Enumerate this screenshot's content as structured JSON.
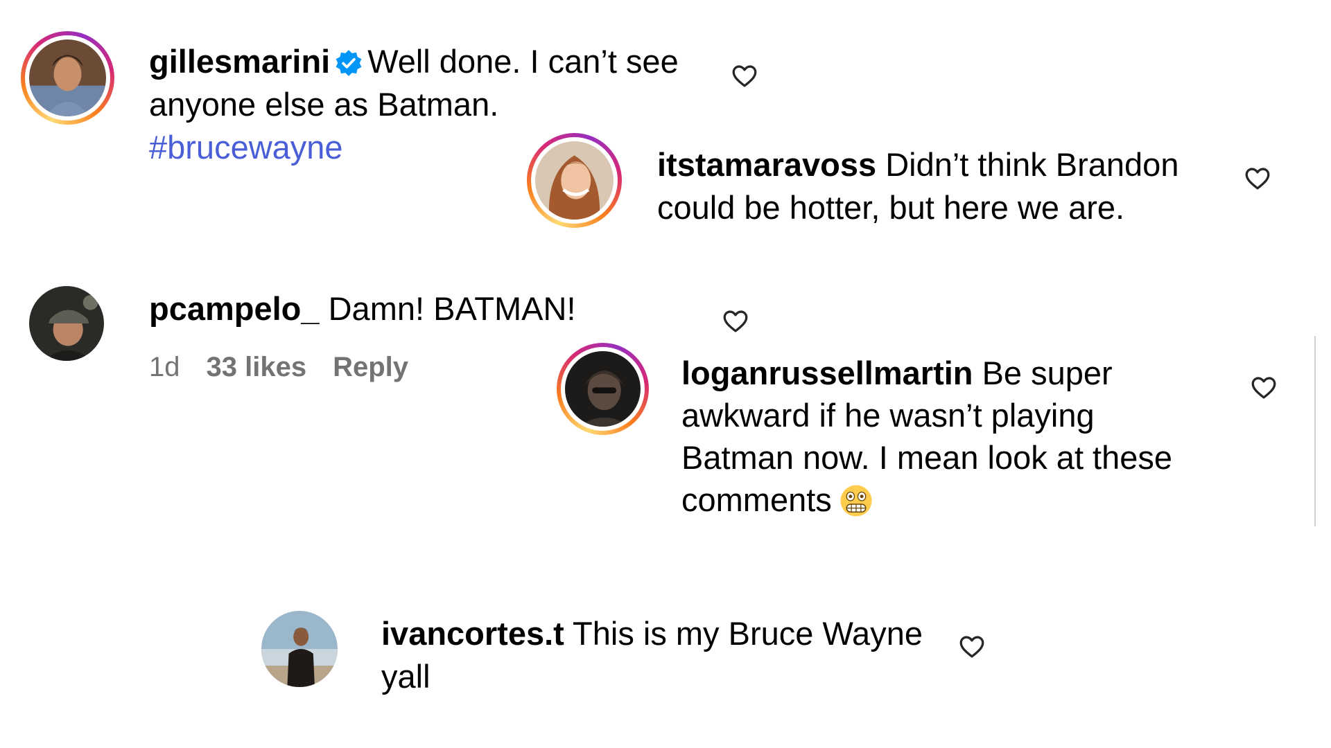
{
  "comments": [
    {
      "username": "gillesmarini",
      "verified": true,
      "text": "Well done. I can’t see anyone else as Batman.",
      "hashtag": "#brucewayne",
      "avatar_icon": "person-photo-dark-hair",
      "story_ring": true
    },
    {
      "username": "itstamaravoss",
      "text": "Didn’t think Brandon could be hotter, but here we are.",
      "avatar_icon": "person-photo-red-hair",
      "story_ring": true
    },
    {
      "username": "pcampelo_",
      "text": "Damn! BATMAN!",
      "time": "1d",
      "likes": "33 likes",
      "reply": "Reply",
      "avatar_icon": "person-photo-cap",
      "story_ring": false
    },
    {
      "username": "loganrussellmartin",
      "text": "Be super awkward if he wasn’t playing Batman now. I mean look at these comments",
      "emoji": "grimacing-face-emoji",
      "avatar_icon": "person-photo-dark",
      "story_ring": true
    },
    {
      "username": "ivancortes.t",
      "text": "This is my Bruce Wayne yall",
      "avatar_icon": "person-photo-beach",
      "story_ring": false
    }
  ],
  "colors": {
    "hashtag": "#4a5ed8",
    "meta": "#737373",
    "verified": "#0095f6",
    "text": "#000000"
  },
  "icons": {
    "like": "heart-outline-icon",
    "verified": "verified-badge-icon"
  }
}
